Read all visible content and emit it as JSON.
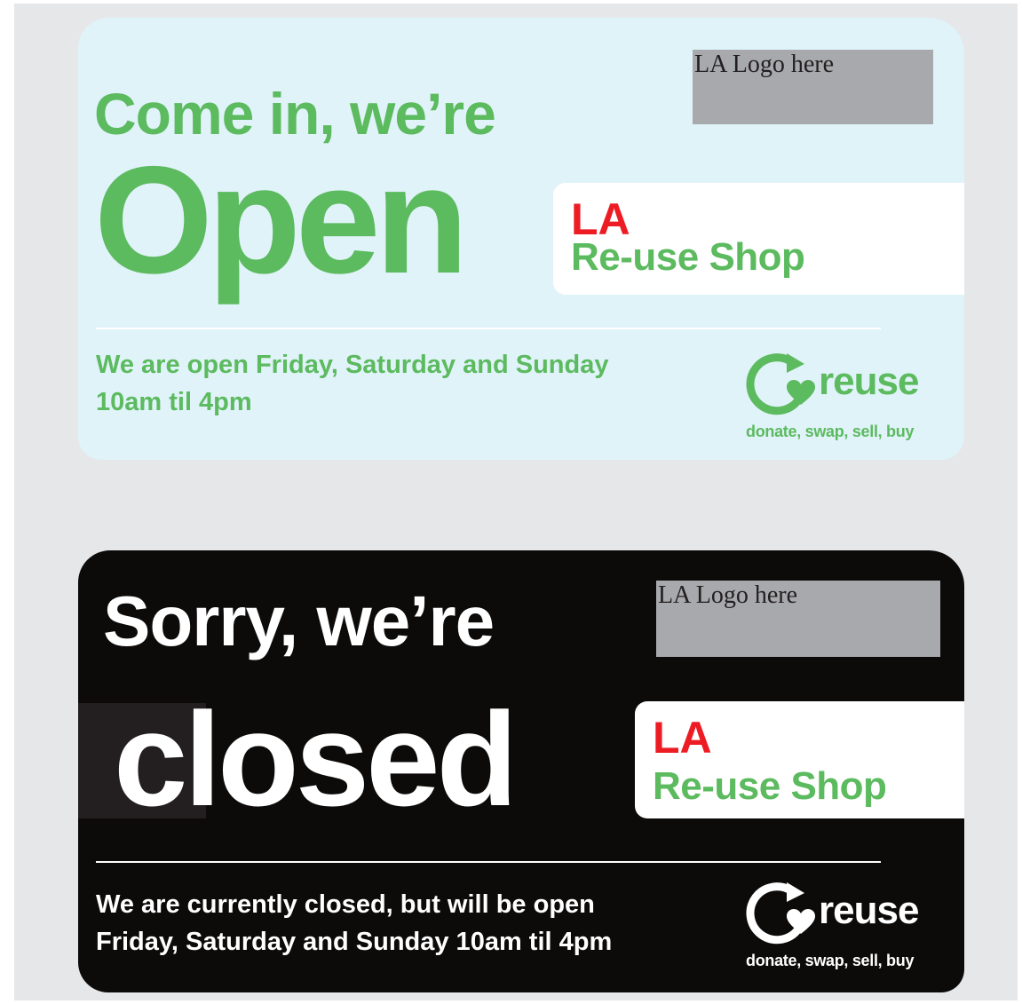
{
  "open_sign": {
    "headline": "Come in, we’re",
    "big_word": "Open",
    "logo_placeholder": "LA Logo here",
    "shop_prefix": "LA",
    "shop_name": "Re-use Shop",
    "info_line1": "We are open Friday, Saturday and Sunday",
    "info_line2": "10am til 4pm",
    "reuse_word": "reuse",
    "reuse_tagline": "donate, swap, sell, buy"
  },
  "closed_sign": {
    "headline": "Sorry, we’re",
    "big_word": "closed",
    "logo_placeholder": "LA Logo here",
    "shop_prefix": "LA",
    "shop_name": "Re-use Shop",
    "info_line1": "We are currently closed, but will be open",
    "info_line2": "Friday, Saturday and Sunday 10am til 4pm",
    "reuse_word": "reuse",
    "reuse_tagline": "donate, swap, sell, buy"
  },
  "icons": {
    "reuse_mark": "reuse-arrow-heart-icon"
  },
  "colors": {
    "green": "#5cba5f",
    "red": "#ed1c24",
    "open_background": "#e0f3f9",
    "closed_background": "#0d0b0a",
    "logo_placeholder": "#a7a9ac"
  }
}
